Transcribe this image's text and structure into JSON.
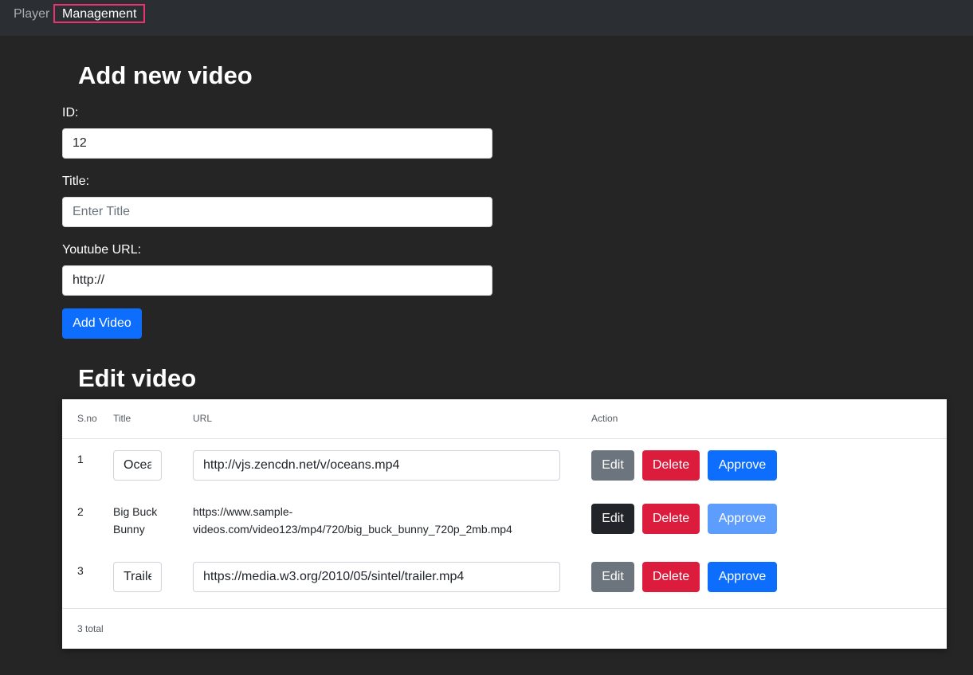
{
  "nav": {
    "items": [
      {
        "label": "Player"
      },
      {
        "label": "Management"
      }
    ]
  },
  "add_form": {
    "heading": "Add new video",
    "id_label": "ID:",
    "id_value": "12",
    "title_label": "Title:",
    "title_placeholder": "Enter Title",
    "url_label": "Youtube URL:",
    "url_value": "http://",
    "submit_label": "Add Video"
  },
  "edit_section": {
    "heading": "Edit video",
    "columns": [
      "S.no",
      "Title",
      "URL",
      "Action"
    ],
    "rows": [
      {
        "sno": "1",
        "title": "Oceans",
        "url": "http://vjs.zencdn.net/v/oceans.mp4",
        "editing": true
      },
      {
        "sno": "2",
        "title_line1": "Big Buck",
        "title_line2": "Bunny",
        "url_line1": "https://www.sample-",
        "url_line2": "videos.com/video123/mp4/720/big_buck_bunny_720p_2mb.mp4",
        "editing": false
      },
      {
        "sno": "3",
        "title": "Trailer",
        "url": "https://media.w3.org/2010/05/sintel/trailer.mp4",
        "editing": true
      }
    ],
    "actions": {
      "edit": "Edit",
      "delete": "Delete",
      "approve": "Approve"
    },
    "footer": "3 total"
  },
  "colors": {
    "background": "#252525",
    "nav_bg": "#2b2f34",
    "highlight_border": "#e8336f",
    "primary": "#0d6efd",
    "danger": "#dc1c3c",
    "secondary": "#6c757d"
  }
}
